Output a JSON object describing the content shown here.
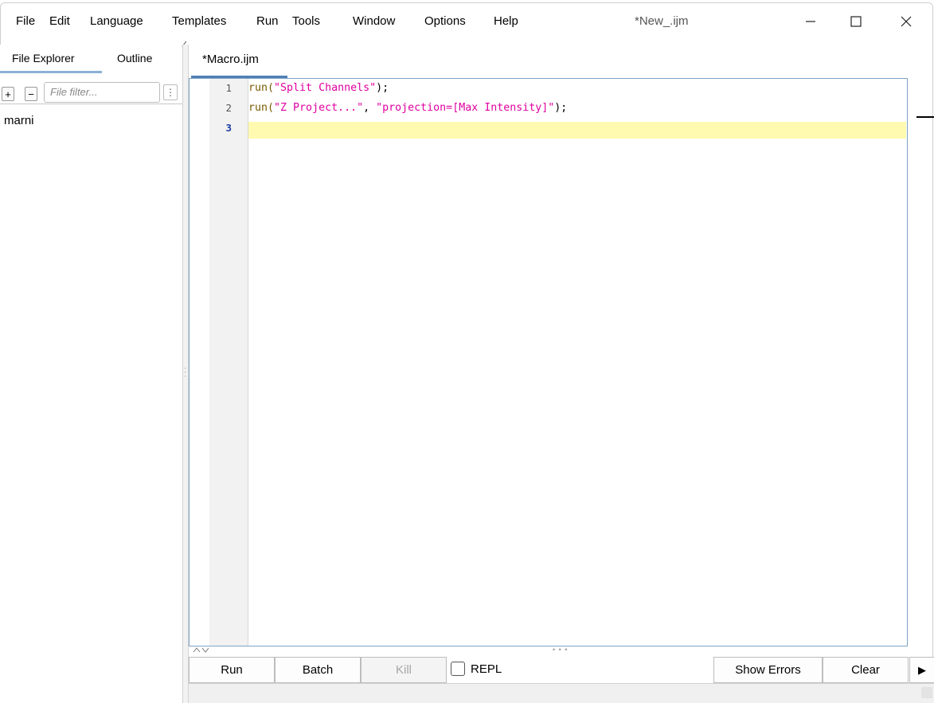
{
  "window": {
    "title": "*New_.ijm",
    "controls": {
      "minimize": "─",
      "maximize": "☐",
      "close": "✕"
    }
  },
  "menubar": {
    "items": [
      "File",
      "Edit",
      "Language",
      "Templates",
      "Run",
      "Tools",
      "Window",
      "Options",
      "Help"
    ]
  },
  "left_panel": {
    "tabs": [
      "File Explorer",
      "Outline"
    ],
    "active_tab": "File Explorer",
    "add_label": "+",
    "remove_label": "−",
    "filter_placeholder": "File filter...",
    "more_label": "⋮",
    "tree_items": [
      "marni"
    ]
  },
  "editor": {
    "tab_label": "*Macro.ijm",
    "lines": [
      {
        "number": "1",
        "fn": "run(",
        "str": "\"Split Channels\"",
        "tail": ");"
      },
      {
        "number": "2",
        "fn": "run(",
        "str": "\"Z Project...\"",
        "mid": ", ",
        "str2": "\"projection=[Max Intensity]\"",
        "tail": ");"
      },
      {
        "number": "3"
      }
    ],
    "current_line": "3"
  },
  "toolbar": {
    "run_label": "Run",
    "batch_label": "Batch",
    "kill_label": "Kill",
    "repl_label": "REPL",
    "repl_checked": false,
    "show_errors_label": "Show Errors",
    "clear_label": "Clear",
    "expand_label": "▶"
  },
  "colors": {
    "current_line_highlight": "#fffab0",
    "string": "#e000a0",
    "function": "#7a5a00",
    "active_line_number": "#1a3da0",
    "tab_underline": "#4f7fb5"
  }
}
